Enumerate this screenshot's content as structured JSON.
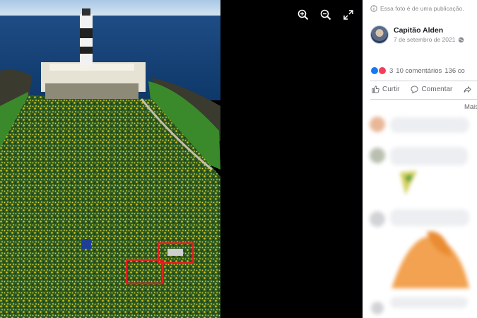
{
  "post": {
    "notice": "Essa foto é de uma publicação.",
    "author_name": "Capitão Alden",
    "date": "7 de setembro de 2021"
  },
  "reactions": {
    "count": "3",
    "comments": "10 comentários",
    "shares": "136 co"
  },
  "actions": {
    "like": "Curtir",
    "comment": "Comentar",
    "share": ""
  },
  "more_label": "Mais",
  "colors": {
    "viewer_bg": "#000000",
    "highlight_box": "#e02020",
    "like_blue": "#1877f2",
    "love_red": "#f33e58"
  },
  "icons": {
    "zoom_in": "zoom-in-icon",
    "zoom_out": "zoom-out-icon",
    "fullscreen": "expand-icon",
    "privacy": "globe-icon"
  }
}
